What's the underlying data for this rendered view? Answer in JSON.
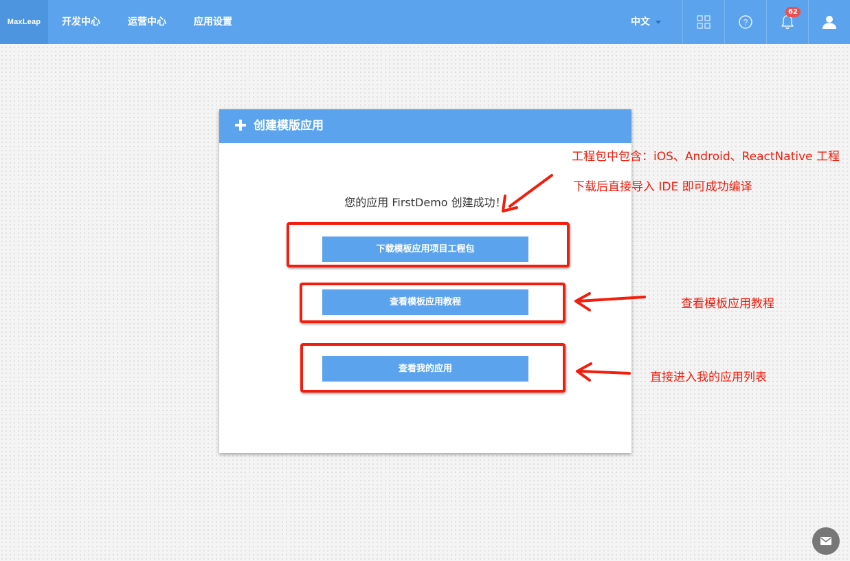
{
  "logo": "MaxLeap",
  "nav": {
    "items": [
      "开发中心",
      "运营中心",
      "应用设置"
    ],
    "language": "中文",
    "notification_count": "62"
  },
  "card": {
    "title": "创建模版应用",
    "success_message": "您的应用 FirstDemo 创建成功！",
    "buttons": {
      "download": "下载模板应用项目工程包",
      "tutorial": "查看模板应用教程",
      "my_apps": "查看我的应用"
    }
  },
  "annotations": {
    "line1": "工程包中包含：iOS、Android、ReactNative 工程",
    "line2": "下载后直接导入 IDE 即可成功编译",
    "tutorial": "查看模板应用教程",
    "my_apps": "直接进入我的应用列表"
  },
  "colors": {
    "primary": "#5ba3ed",
    "annotation": "#f21d0c",
    "badge": "#f04e4e"
  },
  "icons": [
    "grid-icon",
    "help-icon",
    "bell-icon",
    "user-icon",
    "plus-icon",
    "mail-icon"
  ]
}
